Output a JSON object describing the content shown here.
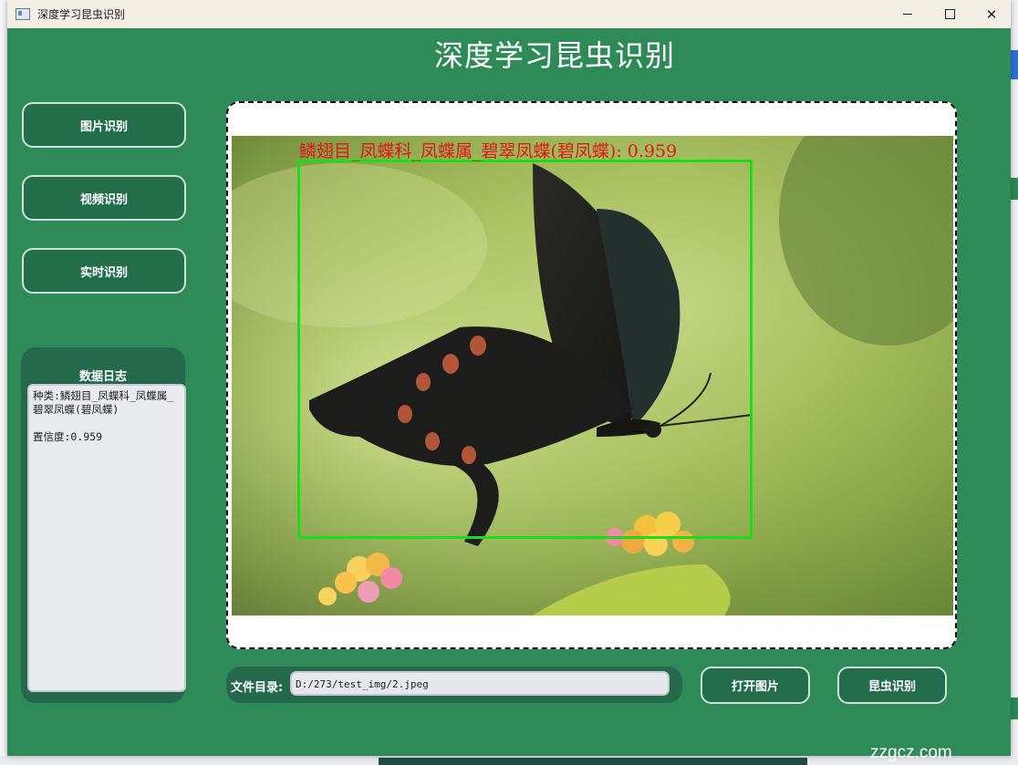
{
  "window": {
    "title": "深度学习昆虫识别"
  },
  "header": {
    "title": "深度学习昆虫识别"
  },
  "sidebar": {
    "buttons": [
      {
        "label": "图片识别"
      },
      {
        "label": "视频识别"
      },
      {
        "label": "实时识别"
      }
    ]
  },
  "log": {
    "title": "数据日志",
    "content": "种类:鳞翅目_凤蝶科_凤蝶属_碧翠凤蝶(碧凤蝶)\n\n置信度:0.959"
  },
  "detection": {
    "label": "鳞翅目_凤蝶科_凤蝶属_碧翠凤蝶(碧凤蝶): 0.959",
    "box_color": "#18e018",
    "label_color": "#e01818"
  },
  "file": {
    "label": "文件目录:",
    "path": "D:/273/test_img/2.jpeg"
  },
  "actions": {
    "open_label": "打开图片",
    "detect_label": "昆虫识别"
  },
  "watermark": "zzgcz.com",
  "colors": {
    "accent": "#2e8b57",
    "panel": "#24694b"
  }
}
